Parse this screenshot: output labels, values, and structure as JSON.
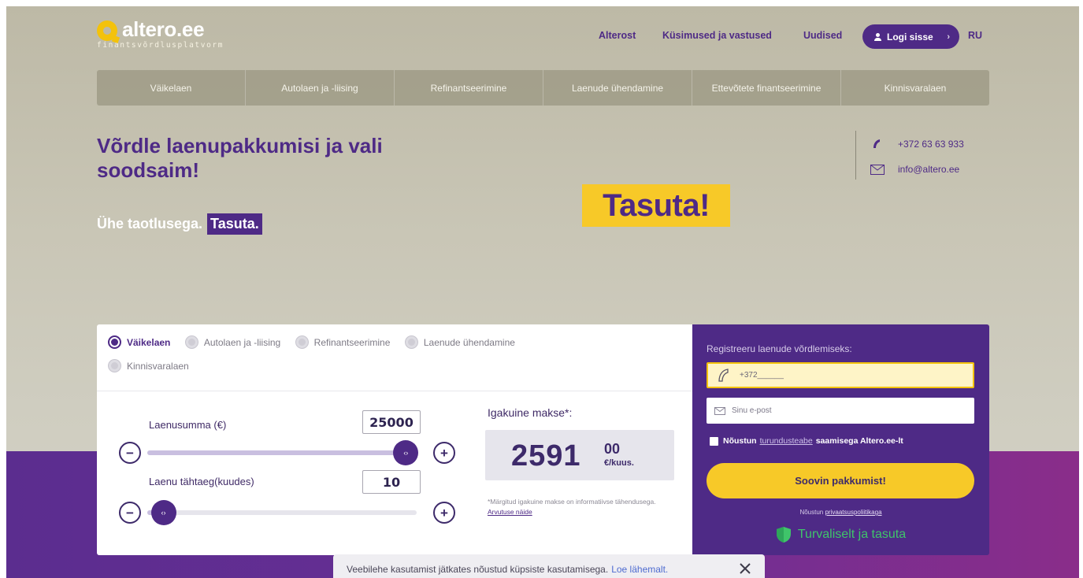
{
  "brand": {
    "name": "altero.ee",
    "tagline": "finantsvõrdlusplatvorm",
    "primary_color": "#4e2a86",
    "accent_color": "#f7c928"
  },
  "topnav": {
    "links": [
      "Alterost",
      "Küsimused ja vastused",
      "Uudised"
    ],
    "login_label": "Logi sisse",
    "language": "RU"
  },
  "categories": [
    "Väikelaen",
    "Autolaen ja -liising",
    "Refinantseerimine",
    "Laenude ühendamine",
    "Ettevõtete finantseerimine",
    "Kinnisvaralaen"
  ],
  "hero": {
    "title": "Võrdle laenupakkumisi ja vali soodsaim!",
    "subtitle": "Ühe taotlusega.",
    "subtitle_highlight": "Tasuta.",
    "badge": "Tasuta!"
  },
  "contact": {
    "phone": "+372 63 63 933",
    "email": "info@altero.ee"
  },
  "calculator": {
    "loan_types": [
      {
        "label": "Väikelaen",
        "selected": true
      },
      {
        "label": "Autolaen ja -liising",
        "selected": false
      },
      {
        "label": "Refinantseerimine",
        "selected": false
      },
      {
        "label": "Laenude ühendamine",
        "selected": false
      },
      {
        "label": "Kinnisvaralaen",
        "selected": false
      }
    ],
    "amount_label": "Laenusumma (€)",
    "amount_value": "25000",
    "amount_fraction": 0.96,
    "term_label": "Laenu tähtaeg(kuudes)",
    "term_value": "10",
    "term_fraction": 0.06,
    "minus": "−",
    "plus": "+",
    "knob_glyph": "‹›",
    "payment_label": "Igakuine makse*:",
    "payment_int": "2591",
    "payment_dec": "00",
    "payment_unit": "€/kuus.",
    "note": "*Märgitud igakuine makse on informatiivse tähendusega.",
    "note_link": "Arvutuse näide"
  },
  "register": {
    "title": "Registreeru laenude võrdlemiseks:",
    "phone_placeholder": "+372______",
    "email_placeholder": "Sinu e-post",
    "consent_prefix": "Nõustun",
    "consent_link": "turundusteabe",
    "consent_suffix": "saamisega Altero.ee-lt",
    "submit_label": "Soovin pakkumist!",
    "privacy_prefix": "Nõustun",
    "privacy_link": "privaatsuspoliitikaga",
    "secure_text": "Turvaliselt ja tasuta",
    "secure_color": "#3fc46a"
  },
  "cookie": {
    "text": "Veebilehe kasutamist jätkates nõustud küpsiste kasutamisega.",
    "link": "Loe lähemalt."
  }
}
